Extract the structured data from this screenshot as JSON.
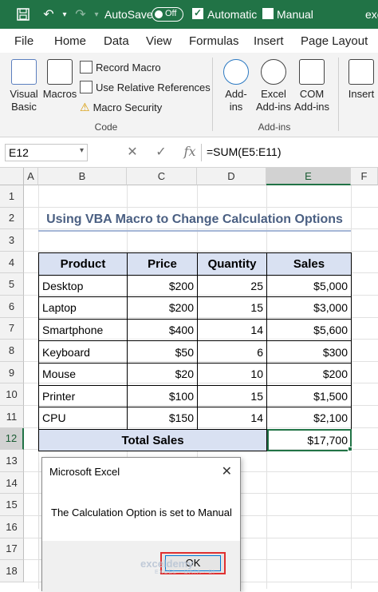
{
  "titlebar": {
    "autosave_label": "AutoSave",
    "autosave_state": "Off",
    "automatic_label": "Automatic",
    "manual_label": "Manual",
    "user_fragment": "exe"
  },
  "tabs": [
    "File",
    "Home",
    "Data",
    "View",
    "Formulas",
    "Insert",
    "Page Layout"
  ],
  "ribbon": {
    "visual_basic": [
      "Visual",
      "Basic"
    ],
    "macros": "Macros",
    "record_macro": "Record Macro",
    "relative_refs": "Use Relative References",
    "macro_security": "Macro Security",
    "code_group": "Code",
    "addins": [
      "Add-",
      "ins"
    ],
    "excel_addins": [
      "Excel",
      "Add-ins"
    ],
    "com_addins": [
      "COM",
      "Add-ins"
    ],
    "addins_group": "Add-ins",
    "insert": "Insert"
  },
  "formula_bar": {
    "name_box": "E12",
    "formula": "=SUM(E5:E11)"
  },
  "columns": [
    "A",
    "B",
    "C",
    "D",
    "E",
    "F"
  ],
  "rows": [
    "1",
    "2",
    "3",
    "4",
    "5",
    "6",
    "7",
    "8",
    "9",
    "10",
    "11",
    "12",
    "13",
    "14",
    "15",
    "16",
    "17",
    "18"
  ],
  "sheet": {
    "title": "Using VBA Macro to Change Calculation Options",
    "headers": [
      "Product",
      "Price",
      "Quantity",
      "Sales"
    ],
    "data_rows": [
      [
        "Desktop",
        "$200",
        "25",
        "$5,000"
      ],
      [
        "Laptop",
        "$200",
        "15",
        "$3,000"
      ],
      [
        "Smartphone",
        "$400",
        "14",
        "$5,600"
      ],
      [
        "Keyboard",
        "$50",
        "6",
        "$300"
      ],
      [
        "Mouse",
        "$20",
        "10",
        "$200"
      ],
      [
        "Printer",
        "$100",
        "15",
        "$1,500"
      ],
      [
        "CPU",
        "$150",
        "14",
        "$2,100"
      ]
    ],
    "total_label": "Total Sales",
    "total_value": "$17,700"
  },
  "dialog": {
    "title": "Microsoft Excel",
    "close": "✕",
    "message": "The Calculation Option is set to Manual",
    "ok": "OK"
  },
  "watermark": {
    "name": "exceldemy",
    "tagline": "EXCEL · DATA · BI"
  },
  "colors": {
    "excel_green": "#217346",
    "header_fill": "#d9e1f2",
    "title_text": "#4a5f82",
    "highlight_red": "#e03131"
  }
}
